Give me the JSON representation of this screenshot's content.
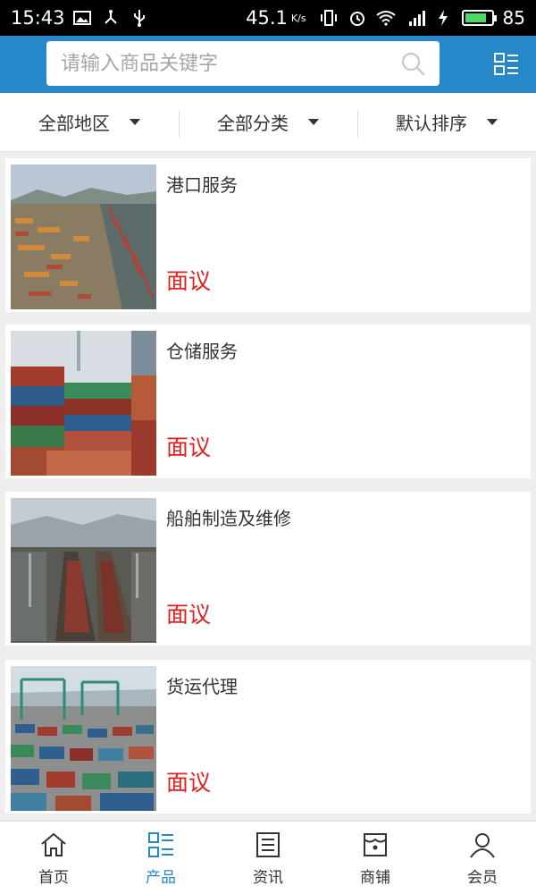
{
  "status_bar": {
    "time": "15:43",
    "speed": "45.1",
    "speed_unit": "K/s",
    "battery": "85",
    "battery_level": 0.85
  },
  "search": {
    "placeholder": "请输入商品关键字"
  },
  "filters": [
    {
      "label": "全部地区"
    },
    {
      "label": "全部分类"
    },
    {
      "label": "默认排序"
    }
  ],
  "products": [
    {
      "name": "港口服务",
      "price": "面议",
      "image": "port-aerial-image"
    },
    {
      "name": "仓储服务",
      "price": "面议",
      "image": "containers-stack-image"
    },
    {
      "name": "船舶制造及维修",
      "price": "面议",
      "image": "shipyard-image"
    },
    {
      "name": "货运代理",
      "price": "面议",
      "image": "container-yard-image"
    }
  ],
  "tabs": [
    {
      "label": "首页",
      "icon": "home-icon",
      "active": false
    },
    {
      "label": "产品",
      "icon": "products-icon",
      "active": true
    },
    {
      "label": "资讯",
      "icon": "news-icon",
      "active": false
    },
    {
      "label": "商铺",
      "icon": "shop-icon",
      "active": false
    },
    {
      "label": "会员",
      "icon": "member-icon",
      "active": false
    }
  ],
  "colors": {
    "header": "#2688c8",
    "price": "#e02020",
    "active_tab": "#2688c8"
  }
}
